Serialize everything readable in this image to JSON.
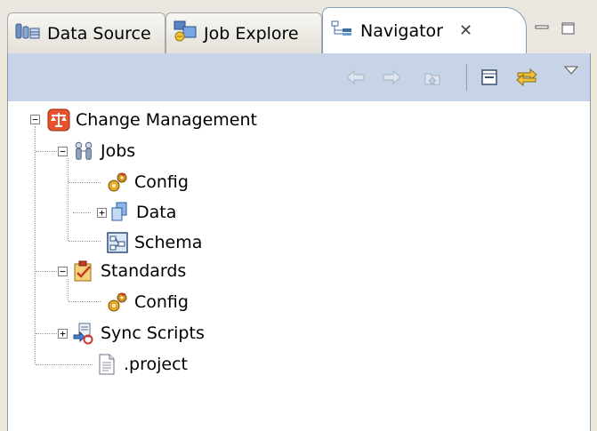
{
  "tabs": [
    {
      "label": "Data Source",
      "icon": "data-source-icon",
      "active": false
    },
    {
      "label": "Job Explore",
      "icon": "job-explorer-icon",
      "active": false
    },
    {
      "label": "Navigator",
      "icon": "navigator-icon",
      "active": true,
      "close_glyph": "✕"
    }
  ],
  "window_controls": {
    "minimize": "minimize-icon",
    "maximize": "maximize-icon"
  },
  "toolbar": {
    "buttons": [
      "back-icon",
      "forward-icon",
      "up-icon",
      "collapse-all-icon",
      "link-with-editor-icon",
      "view-menu-icon"
    ]
  },
  "tree": {
    "root": {
      "label": "Change Management",
      "icon": "change-management-icon",
      "expanded": true
    },
    "items": [
      {
        "label": "Jobs",
        "icon": "jobs-icon",
        "expanded": true
      },
      {
        "label": "Config",
        "icon": "config-icon"
      },
      {
        "label": "Data",
        "icon": "data-icon",
        "expanded": false
      },
      {
        "label": "Schema",
        "icon": "schema-icon"
      },
      {
        "label": "Standards",
        "icon": "standards-icon",
        "expanded": true
      },
      {
        "label": "Config",
        "icon": "config-icon"
      },
      {
        "label": "Sync Scripts",
        "icon": "sync-scripts-icon",
        "expanded": false
      },
      {
        "label": ".project",
        "icon": "file-icon"
      }
    ]
  },
  "colors": {
    "toolbar_bg": "#c7d4e8",
    "frame_border": "#7f9db9",
    "tree_bg": "#ffffff",
    "tab_strip_bg": "#e9e7df"
  }
}
